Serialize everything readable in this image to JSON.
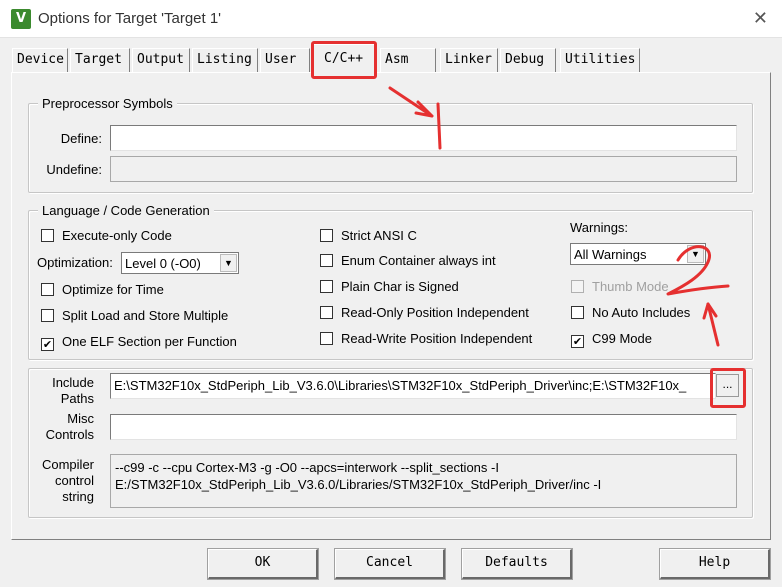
{
  "window": {
    "title": "Options for Target 'Target 1'",
    "close_glyph": "✕",
    "icon_glyph": "V"
  },
  "tabs": [
    "Device",
    "Target",
    "Output",
    "Listing",
    "User",
    "C/C++",
    "Asm",
    "Linker",
    "Debug",
    "Utilities"
  ],
  "active_tab": "C/C++",
  "preprocessor": {
    "legend": "Preprocessor Symbols",
    "define_label": "Define:",
    "define_value": "",
    "undefine_label": "Undefine:",
    "undefine_value": ""
  },
  "language": {
    "legend": "Language / Code Generation",
    "execute_only": {
      "label": "Execute-only Code",
      "checked": false
    },
    "optimization_label": "Optimization:",
    "optimization_value": "Level 0 (-O0)",
    "optimize_time": {
      "label": "Optimize for Time",
      "checked": false
    },
    "split_load": {
      "label": "Split Load and Store Multiple",
      "checked": false
    },
    "one_elf": {
      "label": "One ELF Section per Function",
      "checked": true
    },
    "strict_ansi": {
      "label": "Strict ANSI C",
      "checked": false
    },
    "enum_container": {
      "label": "Enum Container always int",
      "checked": false
    },
    "plain_char": {
      "label": "Plain Char is Signed",
      "checked": false
    },
    "ro_pi": {
      "label": "Read-Only Position Independent",
      "checked": false
    },
    "rw_pi": {
      "label": "Read-Write Position Independent",
      "checked": false
    },
    "warnings_label": "Warnings:",
    "warnings_value": "All Warnings",
    "thumb_mode": {
      "label": "Thumb Mode",
      "checked": false,
      "disabled": true
    },
    "no_auto_includes": {
      "label": "No Auto Includes",
      "checked": false
    },
    "c99_mode": {
      "label": "C99 Mode",
      "checked": true
    }
  },
  "paths": {
    "include_label_line1": "Include",
    "include_label_line2": "Paths",
    "include_value": "E:\\STM32F10x_StdPeriph_Lib_V3.6.0\\Libraries\\STM32F10x_StdPeriph_Driver\\inc;E:\\STM32F10x_",
    "browse_label": "...",
    "misc_label_line1": "Misc",
    "misc_label_line2": "Controls",
    "misc_value": "",
    "compiler_label_line1": "Compiler",
    "compiler_label_line2": "control",
    "compiler_label_line3": "string",
    "compiler_line1": "--c99 -c --cpu Cortex-M3 -g -O0 --apcs=interwork --split_sections -I",
    "compiler_line2": "E:/STM32F10x_StdPeriph_Lib_V3.6.0/Libraries/STM32F10x_StdPeriph_Driver/inc -I"
  },
  "buttons": {
    "ok": "OK",
    "cancel": "Cancel",
    "defaults": "Defaults",
    "help": "Help"
  },
  "check_glyph": "✔",
  "annotations": {
    "color": "#e53030"
  }
}
